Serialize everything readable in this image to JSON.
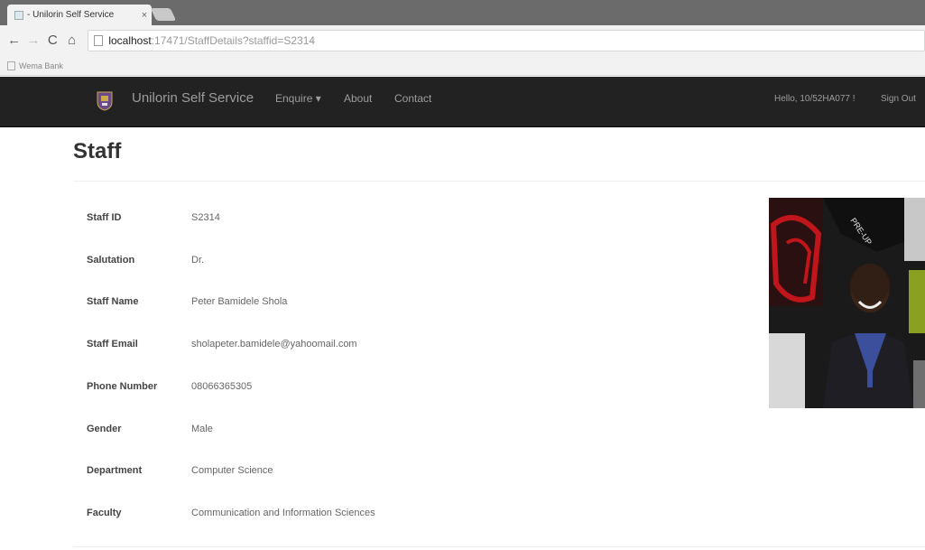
{
  "browser": {
    "tab_title": "- Unilorin Self Service",
    "tab_close": "×",
    "nav_back": "←",
    "nav_forward": "→",
    "nav_reload": "C",
    "nav_home": "⌂",
    "url_host": "localhost",
    "url_path": ":17471/StaffDetails?staffid=S2314",
    "bookmark": "Wema Bank"
  },
  "navbar": {
    "brand": "Unilorin Self Service",
    "items": [
      {
        "label": "Enquire ▾"
      },
      {
        "label": "About"
      },
      {
        "label": "Contact"
      }
    ],
    "greeting": "Hello, 10/52HA077 !",
    "sign_out": "Sign Out"
  },
  "page": {
    "title": "Staff"
  },
  "staff_details": [
    {
      "label": "Staff ID",
      "value": "S2314"
    },
    {
      "label": "Salutation",
      "value": "Dr."
    },
    {
      "label": "Staff Name",
      "value": "Peter Bamidele Shola"
    },
    {
      "label": "Staff Email",
      "value": "sholapeter.bamidele@yahoomail.com"
    },
    {
      "label": "Phone Number",
      "value": "08066365305"
    },
    {
      "label": "Gender",
      "value": "Male"
    },
    {
      "label": "Department",
      "value": "Computer Science"
    },
    {
      "label": "Faculty",
      "value": "Communication and Information Sciences"
    }
  ],
  "colors": {
    "navbar_bg": "#222222",
    "navbar_text": "#9d9d9d",
    "tabstrip": "#6b6b6b"
  }
}
